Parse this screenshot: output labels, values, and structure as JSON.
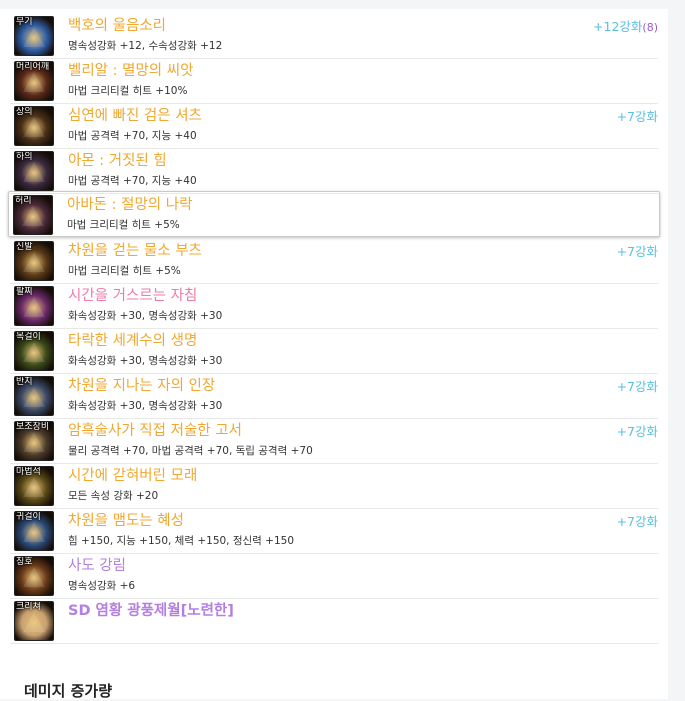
{
  "equipment": [
    {
      "slot": "무기",
      "name": "백호의 울음소리",
      "stat": "명속성강화 +12, 수속성강화 +12",
      "enhance": "+12강화",
      "enhance_extra": "(8)",
      "rarity": "epic",
      "icon_color": "#2f5fa8"
    },
    {
      "slot": "머리어깨",
      "name": "벨리알 : 멸망의 씨앗",
      "stat": "마법 크리티컬 히트 +10%",
      "enhance": "",
      "enhance_extra": "",
      "rarity": "epic",
      "icon_color": "#5a2a1a"
    },
    {
      "slot": "상의",
      "name": "심연에 빠진 검은 셔츠",
      "stat": "마법 공격력 +70, 지능 +40",
      "enhance": "+7강화",
      "enhance_extra": "",
      "rarity": "epic",
      "icon_color": "#4a3018"
    },
    {
      "slot": "하의",
      "name": "아몬 : 거짓된 힘",
      "stat": "마법 공격력 +70, 지능 +40",
      "enhance": "",
      "enhance_extra": "",
      "rarity": "epic",
      "icon_color": "#3a2a40"
    },
    {
      "slot": "허리",
      "name": "아바돈 : 절망의 나락",
      "stat": "마법 크리티컬 히트 +5%",
      "enhance": "",
      "enhance_extra": "",
      "rarity": "epic",
      "icon_color": "#4a2a3a"
    },
    {
      "slot": "신발",
      "name": "차원을 걷는 물소 부츠",
      "stat": "마법 크리티컬 히트 +5%",
      "enhance": "+7강화",
      "enhance_extra": "",
      "rarity": "epic",
      "icon_color": "#5a3a18"
    },
    {
      "slot": "팔찌",
      "name": "시간을 거스르는 자침",
      "stat": "화속성강화 +30, 명속성강화 +30",
      "enhance": "",
      "enhance_extra": "",
      "rarity": "legend",
      "icon_color": "#6a2a6a"
    },
    {
      "slot": "목걸이",
      "name": "타락한 세계수의 생명",
      "stat": "화속성강화 +30, 명속성강화 +30",
      "enhance": "",
      "enhance_extra": "",
      "rarity": "epic",
      "icon_color": "#3a4a1a"
    },
    {
      "slot": "반지",
      "name": "차원을 지나는 자의 인장",
      "stat": "화속성강화 +30, 명속성강화 +30",
      "enhance": "+7강화",
      "enhance_extra": "",
      "rarity": "epic",
      "icon_color": "#3a4a6a"
    },
    {
      "slot": "보조장비",
      "name": "암흑술사가 직접 저술한 고서",
      "stat": "물리 공격력 +70, 마법 공격력 +70, 독립 공격력 +70",
      "enhance": "+7강화",
      "enhance_extra": "",
      "rarity": "epic",
      "icon_color": "#4a3a2a"
    },
    {
      "slot": "마법석",
      "name": "시간에 갇혀버린 모래",
      "stat": "모든 속성 강화 +20",
      "enhance": "",
      "enhance_extra": "",
      "rarity": "epic",
      "icon_color": "#5a4a18"
    },
    {
      "slot": "귀걸이",
      "name": "차원을 맴도는 혜성",
      "stat": "힘 +150, 지능 +150, 체력 +150, 정신력 +150",
      "enhance": "+7강화",
      "enhance_extra": "",
      "rarity": "epic",
      "icon_color": "#2a4a7a"
    },
    {
      "slot": "칭호",
      "name": "사도 강림",
      "stat": "명속성강화 +6",
      "enhance": "",
      "enhance_extra": "",
      "rarity": "unique",
      "icon_color": "#6a3a1a"
    },
    {
      "slot": "크리쳐",
      "name": "SD 염황 광풍제월[노련한]",
      "stat": "",
      "enhance": "",
      "enhance_extra": "",
      "rarity": "unique",
      "icon_color": "#c8a070"
    }
  ],
  "footer_title": "데미지 증가량"
}
